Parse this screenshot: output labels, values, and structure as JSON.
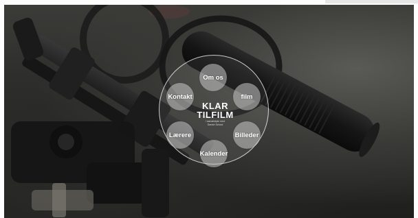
{
  "page": {
    "title": "KLAR TILFILM"
  },
  "logo": {
    "line1": "KLAR",
    "line2": "TILFILM",
    "tagline_1": "i samarbejde med",
    "tagline_2": "Danish School"
  },
  "nav": {
    "items": [
      {
        "id": "om-os",
        "label": "Om os"
      },
      {
        "id": "film",
        "label": "film"
      },
      {
        "id": "billeder",
        "label": "Billeder"
      },
      {
        "id": "kalender",
        "label": "Kalender"
      },
      {
        "id": "laerere",
        "label": "Lærere"
      },
      {
        "id": "kontakt",
        "label": "Kontakt"
      }
    ]
  },
  "colors": {
    "nav_button": "#c8c8c8",
    "ring_border": "#ffffff",
    "text": "#ffffff"
  }
}
